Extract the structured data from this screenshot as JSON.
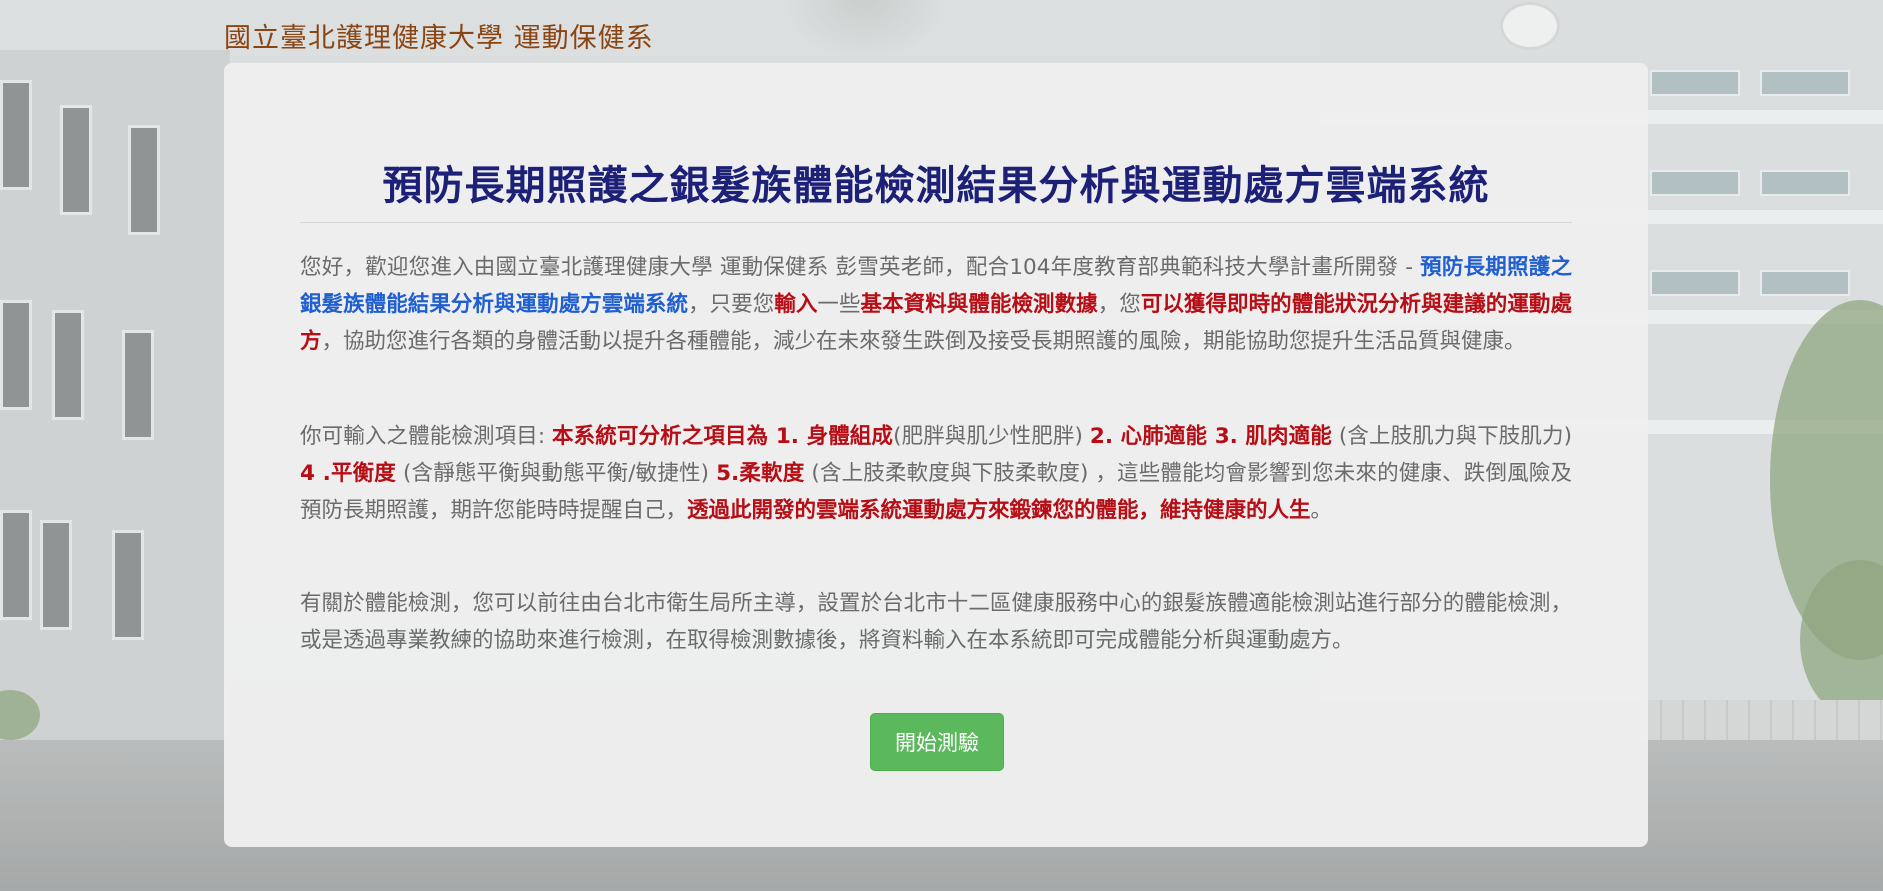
{
  "header": {
    "brand": "國立臺北護理健康大學 運動保健系"
  },
  "main": {
    "title": "預防長期照護之銀髮族體能檢測結果分析與運動處方雲端系統",
    "p1": {
      "t1": "您好，歡迎您進入由國立臺北護理健康大學 運動保健系 彭雪英老師，配合104年度教育部典範科技大學計畫所開發 - ",
      "h1": "預防長期照護之銀髮族體能結果分析與運動處方雲端系統",
      "t2": "，只要您",
      "h2": "輸入",
      "t3": "一些",
      "h3": "基本資料與體能檢測數據",
      "t4": "，您",
      "h4": "可以獲得即時的體能狀況分析與建議的運動處方",
      "t5": "，協助您進行各類的身體活動以提升各種體能，減少在未來發生跌倒及接受長期照護的風險，期能協助您提升生活品質與健康。"
    },
    "p2": {
      "t1": "你可輸入之體能檢測項目: ",
      "h1": "本系統可分析之項目為 1. 身體組成",
      "t2": "(肥胖與肌少性肥胖) ",
      "h2": "2. 心肺適能 3. 肌肉適能",
      "t3": " (含上肢肌力與下肢肌力) ",
      "h3": "4 .平衡度",
      "t4": " (含靜態平衡與動態平衡/敏捷性) ",
      "h4": "5.柔軟度",
      "t5": " (含上肢柔軟度與下肢柔軟度) ，這些體能均會影響到您未來的健康、跌倒風險及預防長期照護，期許您能時時提醒自己，",
      "h5": "透過此開發的雲端系統運動處方來鍛鍊您的體能，維持健康的人生",
      "t6": "。"
    },
    "p3": "有關於體能檢測，您可以前往由台北市衛生局所主導，設置於台北市十二區健康服務中心的銀髮族體適能檢測站進行部分的體能檢測，或是透過專業教練的協助來進行檢測，在取得檢測數據後，將資料輸入在本系統即可完成體能分析與運動處方。",
    "start_button": "開始測驗"
  },
  "colors": {
    "brand": "#8b4513",
    "title": "#1c2077",
    "highlight_blue": "#1f5fd0",
    "highlight_red": "#b70d15",
    "button": "#5cb85c"
  }
}
